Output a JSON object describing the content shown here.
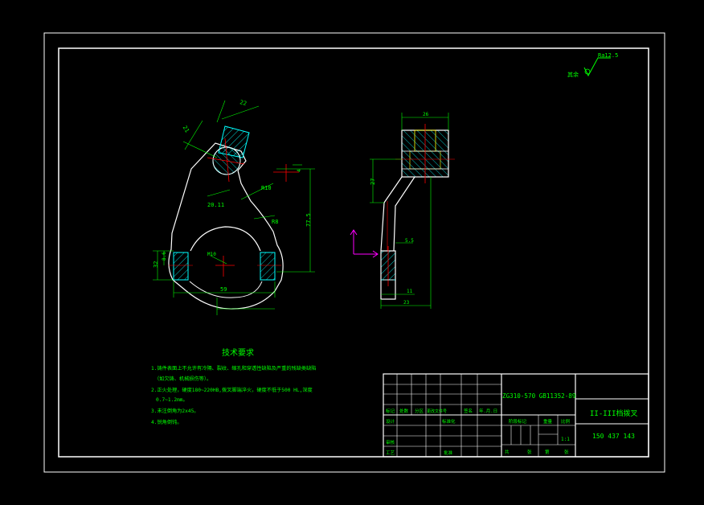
{
  "colors": {
    "background": "#000000",
    "frame": "#ffffff",
    "text": "#00ff00",
    "dim": "#00ff00",
    "hatch": "#00ffff",
    "section_outline": "#00ffff",
    "center": "#ff0000",
    "material": "#ffff00",
    "axis": "#ff00ff"
  },
  "roughness": {
    "label": "其余",
    "value": "Ra12.5"
  },
  "dims": {
    "left_top_w": "22",
    "left_top_h": "21",
    "left_r": "R10",
    "left_angle": "20.11",
    "left_r2": "R8",
    "left_hole": "M10",
    "left_h": "77.5",
    "left_bottom_w": "59",
    "left_small_h": "32",
    "left_small_v": "8.6",
    "left_side": "4",
    "right_top_w": "26",
    "right_v": "27",
    "right_step": "5.5",
    "right_pin": "11",
    "right_bottom_w": "23"
  },
  "tech": {
    "title": "技术要求",
    "lines": [
      "1.铸件表面上不允许有冷隔、裂纹、缩孔和穿透性缺陷及严重的残缺类缺陷",
      "（如欠铸、机械损伤等）。",
      "2.正火处理，硬度180~220HB,拨叉脚端淬火，硬度不低于500 HL,深度",
      "0.7~1.2mm。",
      "3.未注倒角为2x45。",
      "4.锐角倒钝。"
    ]
  },
  "title_block": {
    "material": "ZG310-570 GB11352-89",
    "part_name": "II-III档拨叉",
    "part_no": "150 437 143",
    "row_labels": [
      "标记",
      "处数",
      "分区",
      "更改文件号",
      "签名",
      "年.月.日"
    ],
    "design": "设计",
    "standard": "标准化",
    "review": "审核",
    "process": "工艺",
    "approve": "批准",
    "stage_label": "阶段标记",
    "weight_label": "重量",
    "scale_label": "比例",
    "scale": "1:1",
    "sheet": "共",
    "sheet_of": "张",
    "sheet2": "第",
    "sheet2_of": "张"
  }
}
